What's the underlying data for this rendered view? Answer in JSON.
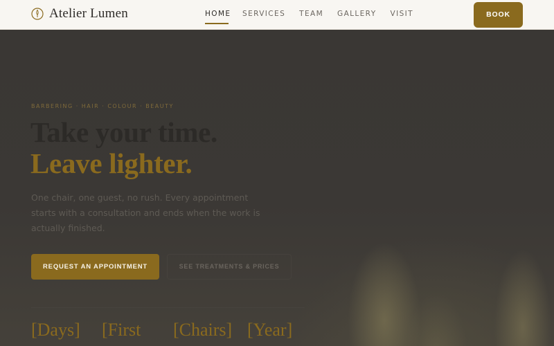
{
  "header": {
    "brand_name": "Atelier Lumen",
    "nav": [
      "HOME",
      "SERVICES",
      "TEAM",
      "GALLERY",
      "VISIT"
    ],
    "book_label": "BOOK"
  },
  "hero": {
    "eyebrow": "BARBERING · HAIR · COLOUR · BEAUTY",
    "headline_line1": "Take your time.",
    "headline_line2": "Leave lighter.",
    "lede": "One chair, one guest, no rush. Every appointment starts with a consultation and ends when the work is actually finished.",
    "primary_cta": "REQUEST AN APPOINTMENT",
    "secondary_cta": "SEE TREATMENTS & PRICES",
    "stats": [
      "[Days]",
      "[First",
      "[Chairs]",
      "[Year]"
    ]
  },
  "colors": {
    "accent": "#8a6a1e",
    "header_bg": "#f8f6f2",
    "hero_bg": "#3b3835"
  },
  "icons": {
    "brand": "candle-flame-icon"
  }
}
